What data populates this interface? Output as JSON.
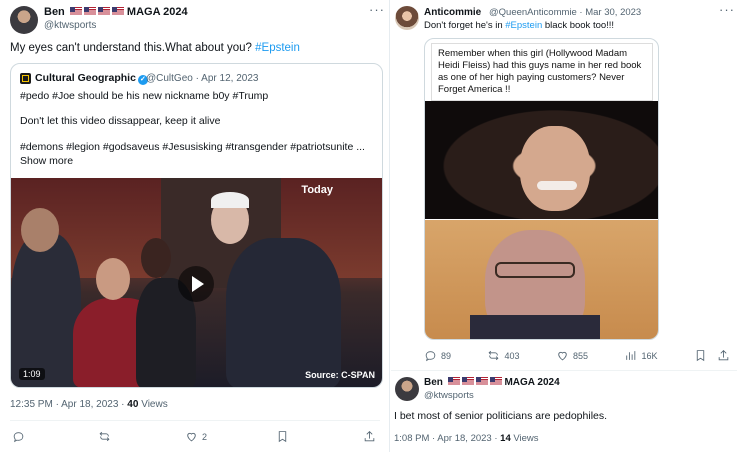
{
  "left_tweet": {
    "author_name": "Ben",
    "author_suffix": "MAGA 2024",
    "handle": "@ktwsports",
    "text_plain": "My  eyes can't understand this.What about you?",
    "hashtag": "#Epstein",
    "quote": {
      "name": "Cultural Geographic",
      "handle_date": "@CultGeo · Apr 12, 2023",
      "line1": "#pedo #Joe should be his new nickname b0y #Trump",
      "line2": "Don't let this video dissappear, keep it alive",
      "line3": "#demons #legion #godsaveus #Jesusisking #transgender #patriotsunite ...",
      "show_more": "Show more",
      "video": {
        "overlay_label": "Today",
        "duration": "1:09",
        "source": "Source: C-SPAN"
      }
    },
    "timestamp": "12:35 PM · Apr 18, 2023 ·",
    "views_count": "40",
    "views_label": "Views",
    "actions": {
      "reply": "",
      "retweet": "",
      "like": "2",
      "bookmark": "",
      "share": ""
    }
  },
  "right_tweet": {
    "author_name": "Anticommie",
    "handle_date": "@QueenAnticommie · Mar 30, 2023",
    "text_before": "Don't forget he's in",
    "hashtag": "#Epstein",
    "text_after": "black book too!!!",
    "media_caption": "Remember when this girl (Hollywood Madam Heidi Fleiss) had this guys name in her red book as one of her high paying customers? Never Forget America !!",
    "actions": {
      "reply": "89",
      "retweet": "403",
      "like": "855",
      "views": "16K"
    }
  },
  "reply_tweet": {
    "author_name": "Ben",
    "author_suffix": "MAGA 2024",
    "handle": "@ktwsports",
    "text": "I bet most of senior politicians are pedophiles.",
    "timestamp": "1:08 PM · Apr 18, 2023 ·",
    "views_count": "14",
    "views_label": "Views"
  }
}
